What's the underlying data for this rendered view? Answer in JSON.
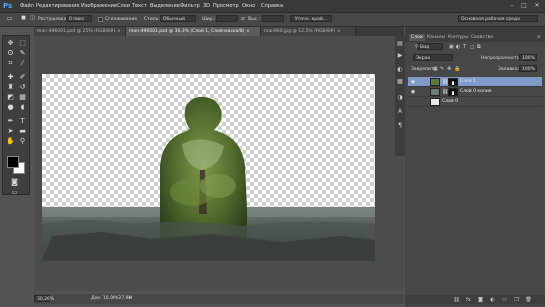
{
  "app": {
    "logo": "Ps"
  },
  "menu": {
    "items": [
      "Файл",
      "Редактирование",
      "Изображение",
      "Слои",
      "Текст",
      "Выделение",
      "Фильтр",
      "3D",
      "Просмотр",
      "Окно",
      "Справка"
    ]
  },
  "window_controls": {
    "minimize": "–",
    "maximize": "□",
    "close": "✕"
  },
  "options_bar": {
    "feather_label": "Растушевка:",
    "feather_value": "0 пикс",
    "antialias_label": "Сглаживание",
    "style_label": "Стиль:",
    "style_value": "Обычный",
    "width_label": "Шир.:",
    "height_label": "Выс.:",
    "refine_edge_button": "Уточн. край...",
    "workspace_value": "Основная рабочая среда"
  },
  "tabs": [
    {
      "label": "man-496001.psd @ 25% (RGB/8#) ×",
      "active": false
    },
    {
      "label": "man-496001.psd @ 30,3% (Слой 1, Слой-маска/8) ×",
      "active": true
    },
    {
      "label": "man960.jpg @ 12,5% (RGB/8#) ×",
      "active": false
    }
  ],
  "status": {
    "zoom": "30,26%",
    "doc_size": "Док: 10,9М/27,9М"
  },
  "panel": {
    "tabs": [
      "Слои",
      "Каналы",
      "Контуры",
      "Свойства"
    ],
    "filter_value": "Вид",
    "blend_mode": "Экран",
    "opacity_label": "Непрозрачность:",
    "opacity_value": "100%",
    "lock_label": "Закрепить:",
    "fill_label": "Заливка:",
    "fill_value": "100%"
  },
  "layers": [
    {
      "name": "Слой 1",
      "visible": true,
      "selected": true,
      "mask": true
    },
    {
      "name": "Слой 0 копия",
      "visible": true,
      "selected": false,
      "mask": true
    },
    {
      "name": "Слой 0",
      "visible": false,
      "selected": false,
      "mask": false
    }
  ],
  "colors": {
    "accent": "#7f9ac8",
    "background": "#535353",
    "foreground_swatch": "#000000",
    "background_swatch": "#ffffff"
  }
}
